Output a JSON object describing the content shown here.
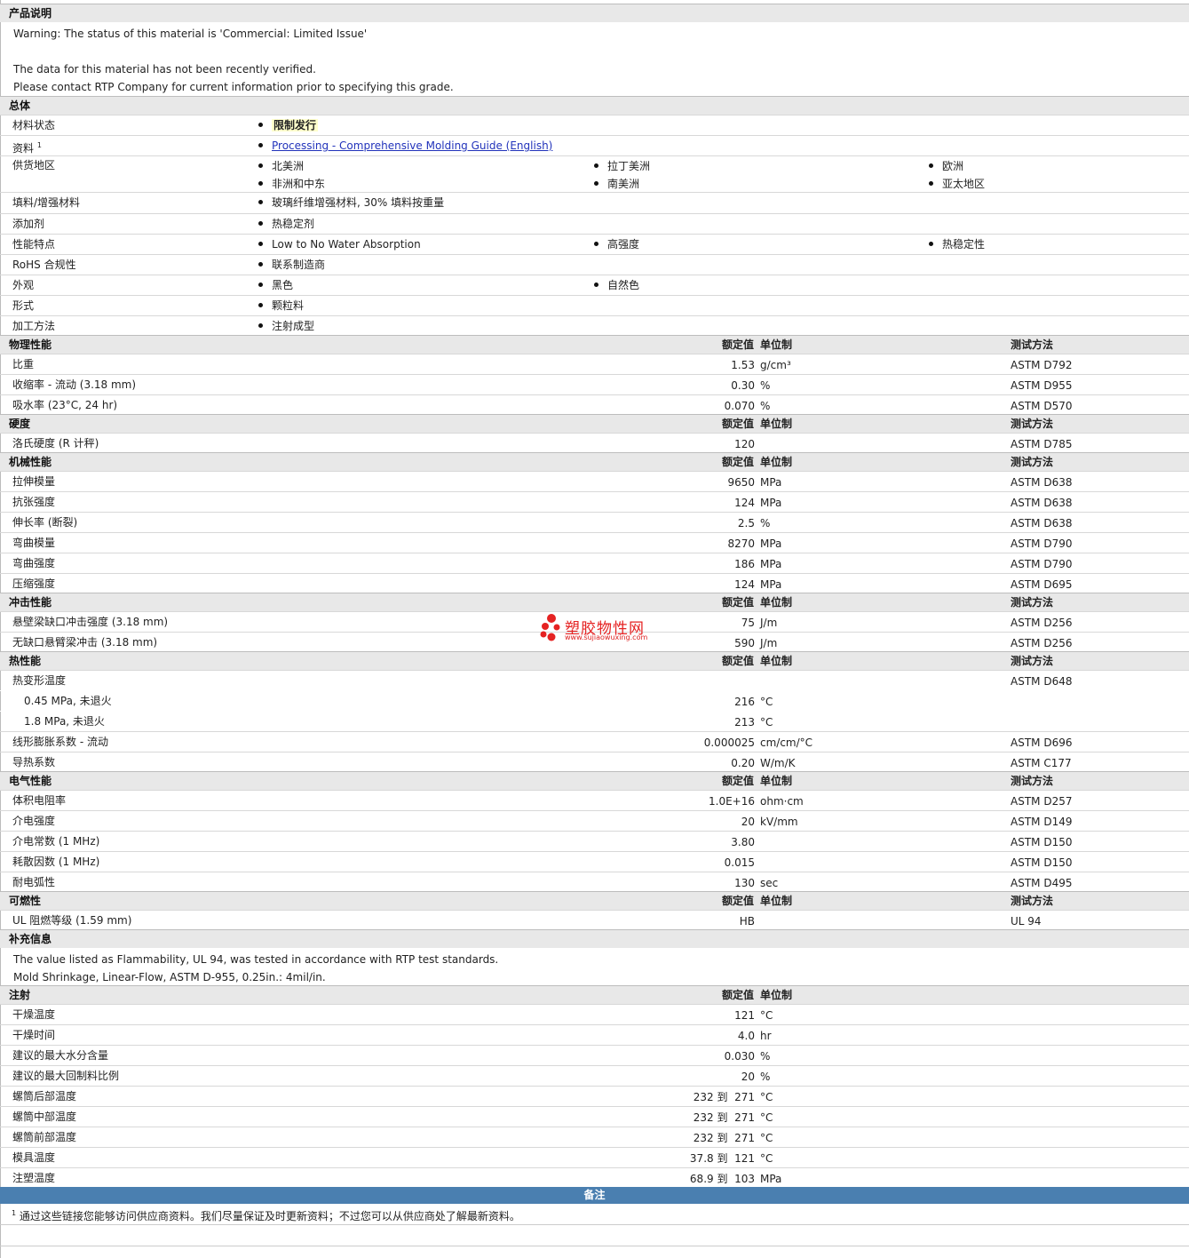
{
  "product_desc": {
    "title": "产品说明",
    "lines": [
      "Warning: The status of this material is 'Commercial: Limited Issue'",
      "The data for this material has not been recently verified.",
      "Please contact RTP Company for current information prior to specifying this grade."
    ]
  },
  "general": {
    "title": "总体",
    "rows": [
      {
        "label": "材料状态",
        "items": [
          "限制发行"
        ]
      },
      {
        "label": "资料",
        "sup": "1",
        "items": [
          "Processing - Comprehensive Molding Guide (English)"
        ]
      },
      {
        "label": "供货地区",
        "items": [
          "北美洲",
          "拉丁美洲",
          "欧洲",
          "非洲和中东",
          "南美洲",
          "亚太地区"
        ]
      },
      {
        "label": "填料/增强材料",
        "items": [
          "玻璃纤维增强材料, 30% 填料按重量"
        ]
      },
      {
        "label": "添加剂",
        "items": [
          "热稳定剂"
        ]
      },
      {
        "label": "性能特点",
        "items": [
          "Low to No Water Absorption",
          "高强度",
          "热稳定性"
        ]
      },
      {
        "label": "RoHS 合规性",
        "items": [
          "联系制造商"
        ]
      },
      {
        "label": "外观",
        "items": [
          "黑色",
          "自然色"
        ]
      },
      {
        "label": "形式",
        "items": [
          "颗粒料"
        ]
      },
      {
        "label": "加工方法",
        "items": [
          "注射成型"
        ]
      }
    ]
  },
  "col_headers": {
    "value": "额定值",
    "unit": "单位制",
    "method": "测试方法"
  },
  "physical": {
    "title": "物理性能",
    "rows": [
      {
        "label": "比重",
        "value": "1.53",
        "unit": "g/cm³",
        "method": "ASTM D792"
      },
      {
        "label": "收缩率 - 流动 (3.18 mm)",
        "value": "0.30",
        "unit": "%",
        "method": "ASTM D955"
      },
      {
        "label": "吸水率 (23°C, 24 hr)",
        "value": "0.070",
        "unit": "%",
        "method": "ASTM D570"
      }
    ]
  },
  "hardness": {
    "title": "硬度",
    "rows": [
      {
        "label": "洛氏硬度 (R 计秤)",
        "value": "120",
        "unit": "",
        "method": "ASTM D785"
      }
    ]
  },
  "mechanical": {
    "title": "机械性能",
    "rows": [
      {
        "label": "拉伸模量",
        "value": "9650",
        "unit": "MPa",
        "method": "ASTM D638"
      },
      {
        "label": "抗张强度",
        "value": "124",
        "unit": "MPa",
        "method": "ASTM D638"
      },
      {
        "label": "伸长率 (断裂)",
        "value": "2.5",
        "unit": "%",
        "method": "ASTM D638"
      },
      {
        "label": "弯曲模量",
        "value": "8270",
        "unit": "MPa",
        "method": "ASTM D790"
      },
      {
        "label": "弯曲强度",
        "value": "186",
        "unit": "MPa",
        "method": "ASTM D790"
      },
      {
        "label": "压缩强度",
        "value": "124",
        "unit": "MPa",
        "method": "ASTM D695"
      }
    ]
  },
  "impact": {
    "title": "冲击性能",
    "rows": [
      {
        "label": "悬壁梁缺口冲击强度 (3.18 mm)",
        "value": "75",
        "unit": "J/m",
        "method": "ASTM D256"
      },
      {
        "label": "无缺口悬臂梁冲击 (3.18 mm)",
        "value": "590",
        "unit": "J/m",
        "method": "ASTM D256"
      }
    ]
  },
  "thermal": {
    "title": "热性能",
    "rows": [
      {
        "label": "热变形温度",
        "value": "",
        "unit": "",
        "method": "ASTM D648"
      },
      {
        "label": "0.45 MPa, 未退火",
        "indent": true,
        "value": "216",
        "unit": "°C",
        "method": ""
      },
      {
        "label": "1.8 MPa, 未退火",
        "indent": true,
        "value": "213",
        "unit": "°C",
        "method": ""
      },
      {
        "label": "线形膨胀系数 - 流动",
        "value": "0.000025",
        "unit": "cm/cm/°C",
        "method": "ASTM D696"
      },
      {
        "label": "导热系数",
        "value": "0.20",
        "unit": "W/m/K",
        "method": "ASTM C177"
      }
    ]
  },
  "electrical": {
    "title": "电气性能",
    "rows": [
      {
        "label": "体积电阻率",
        "value": "1.0E+16",
        "unit": "ohm·cm",
        "method": "ASTM D257"
      },
      {
        "label": "介电强度",
        "value": "20",
        "unit": "kV/mm",
        "method": "ASTM D149"
      },
      {
        "label": "介电常数 (1 MHz)",
        "value": "3.80",
        "unit": "",
        "method": "ASTM D150"
      },
      {
        "label": "耗散因数 (1 MHz)",
        "value": "0.015",
        "unit": "",
        "method": "ASTM D150"
      },
      {
        "label": "耐电弧性",
        "value": "130",
        "unit": "sec",
        "method": "ASTM D495"
      }
    ]
  },
  "flammability": {
    "title": "可燃性",
    "rows": [
      {
        "label": "UL 阻燃等级 (1.59 mm)",
        "value": "HB",
        "unit": "",
        "method": "UL 94"
      }
    ]
  },
  "supplemental": {
    "title": "补充信息",
    "lines": [
      "The value listed as Flammability, UL 94, was tested in accordance with RTP test standards.",
      "Mold Shrinkage, Linear-Flow, ASTM D-955, 0.25in.: 4mil/in."
    ]
  },
  "injection": {
    "title": "注射",
    "rows": [
      {
        "label": "干燥温度",
        "value": "121",
        "unit": "°C"
      },
      {
        "label": "干燥时间",
        "value": "4.0",
        "unit": "hr"
      },
      {
        "label": "建议的最大水分含量",
        "value": "0.030",
        "unit": "%"
      },
      {
        "label": "建议的最大回制料比例",
        "value": "20",
        "unit": "%"
      },
      {
        "label": "螺筒后部温度",
        "value": "232 到  271",
        "unit": "°C"
      },
      {
        "label": "螺筒中部温度",
        "value": "232 到  271",
        "unit": "°C"
      },
      {
        "label": "螺筒前部温度",
        "value": "232 到  271",
        "unit": "°C"
      },
      {
        "label": "模具温度",
        "value": "37.8 到  121",
        "unit": "°C"
      },
      {
        "label": "注塑温度",
        "value": "68.9 到  103",
        "unit": "MPa"
      }
    ]
  },
  "notes": {
    "title": "备注",
    "sup": "1",
    "text": "通过这些链接您能够访问供应商资料。我们尽量保证及时更新资料；不过您可以从供应商处了解最新资料。"
  },
  "watermark": {
    "name": "塑胶物性网",
    "url": "www.sujiaowuxing.com",
    "color": "#e52222"
  }
}
